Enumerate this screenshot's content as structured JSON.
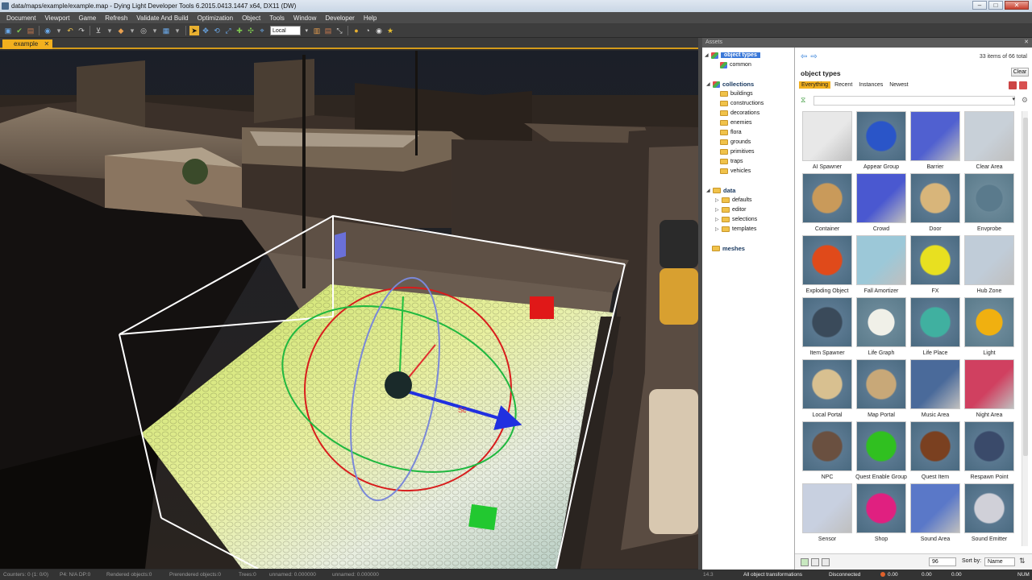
{
  "window": {
    "title": "data/maps/example/example.map - Dying Light Developer Tools 6.2015.0413.1447 x64, DX11 (DW)",
    "controls": [
      "–",
      "□",
      "✕"
    ]
  },
  "menu": [
    "Document",
    "Viewport",
    "Game",
    "Refresh",
    "Validate And Build",
    "Optimization",
    "Object",
    "Tools",
    "Window",
    "Developer",
    "Help"
  ],
  "toolbar": {
    "coord_space": "Local"
  },
  "document_tab": {
    "label": "example",
    "close": "✕"
  },
  "viewport": {
    "gizmo_label": "Sc"
  },
  "assets": {
    "header": "Assets",
    "pin_close": "✕",
    "tree": {
      "object_types": "object types",
      "common": "common",
      "collections": "collections",
      "collection_items": [
        "buildings",
        "constructions",
        "decorations",
        "enemies",
        "flora",
        "grounds",
        "primitives",
        "traps",
        "vehicles"
      ],
      "data": "data",
      "data_items": [
        "defaults",
        "editor",
        "selections",
        "templates"
      ],
      "meshes": "meshes"
    },
    "browser": {
      "count": "33 items of 66 total",
      "title": "object types",
      "clear": "Clear",
      "filters": [
        "Everything",
        "Recent",
        "Instances",
        "Newest"
      ],
      "items": [
        {
          "label": "AI Spawner",
          "icon": "dice-cube-icon",
          "color": "#e8e8e8"
        },
        {
          "label": "Appear Group",
          "icon": "eye-icon",
          "color": "#2a55c8"
        },
        {
          "label": "Barrier",
          "icon": "cube-icon",
          "color": "#5060d0"
        },
        {
          "label": "Clear Area",
          "icon": "cube-icon",
          "color": "#c8d0d8"
        },
        {
          "label": "Container",
          "icon": "basket-icon",
          "color": "#c99a5a"
        },
        {
          "label": "Crowd",
          "icon": "crowd-cube-icon",
          "color": "#4a58d0"
        },
        {
          "label": "Door",
          "icon": "door-icon",
          "color": "#d8b57a"
        },
        {
          "label": "Envprobe",
          "icon": "sphere-icon",
          "color": "#5a7a8c"
        },
        {
          "label": "Exploding Object",
          "icon": "barrel-icon",
          "color": "#e04a1a"
        },
        {
          "label": "Fall Amortizer",
          "icon": "cube-icon",
          "color": "#9cc8d8"
        },
        {
          "label": "FX",
          "icon": "star-burst-icon",
          "color": "#e8e020"
        },
        {
          "label": "Hub Zone",
          "icon": "cube-icon",
          "color": "#c0ccd8"
        },
        {
          "label": "Item Spawner",
          "icon": "crate-icon",
          "color": "#3a4a5a"
        },
        {
          "label": "Life Graph",
          "icon": "disc-icon",
          "color": "#f0f0e8"
        },
        {
          "label": "Life Place",
          "icon": "circular-arrow-icon",
          "color": "#40b0a0"
        },
        {
          "label": "Light",
          "icon": "bulb-sphere-icon",
          "color": "#f0b010"
        },
        {
          "label": "Local Portal",
          "icon": "cabinet-icon",
          "color": "#d8c090"
        },
        {
          "label": "Map Portal",
          "icon": "wardrobe-icon",
          "color": "#c8a878"
        },
        {
          "label": "Music Area",
          "icon": "cube-icon",
          "color": "#4a6a9a"
        },
        {
          "label": "Night Area",
          "icon": "cube-icon",
          "color": "#d04060"
        },
        {
          "label": "NPC",
          "icon": "person-icon",
          "color": "#6a5040"
        },
        {
          "label": "Quest Enable Group",
          "icon": "gears-icon",
          "color": "#30c020"
        },
        {
          "label": "Quest Item",
          "icon": "book-icon",
          "color": "#7a4020"
        },
        {
          "label": "Respawn Point",
          "icon": "flag-icon",
          "color": "#3a4a6a"
        },
        {
          "label": "Sensor",
          "icon": "cube-icon",
          "color": "#c8d0e0"
        },
        {
          "label": "Shop",
          "icon": "shop-icon",
          "color": "#e02080"
        },
        {
          "label": "Sound Area",
          "icon": "cube-icon",
          "color": "#5a78c8"
        },
        {
          "label": "Sound Emitter",
          "icon": "speaker-icon",
          "color": "#d0d0d8"
        }
      ],
      "size": "96",
      "sort_label": "Sort by:",
      "sort_value": "Name"
    }
  },
  "status": {
    "counters": "Counters: 0 (1: 0/0)",
    "pf": "P4: N/A  DP:0",
    "rendered": "Rendered objects:0",
    "prerendered": "Prerendered objects:0",
    "trees": "Trees:0",
    "unnamed1": "unnamed: 0.000000",
    "unnamed2": "unnamed: 0.000000",
    "version": "14.3",
    "transforms": "All object transformations",
    "connection": "Disconnected",
    "v1": "0.00",
    "v2": "0.00",
    "v3": "0.00",
    "num": "NUM"
  },
  "colors": {
    "accent": "#f2b01e",
    "selection": "#3a78d8",
    "gizmo_x": "#e02020",
    "gizmo_y": "#20c040",
    "gizmo_z": "#2030e0"
  }
}
